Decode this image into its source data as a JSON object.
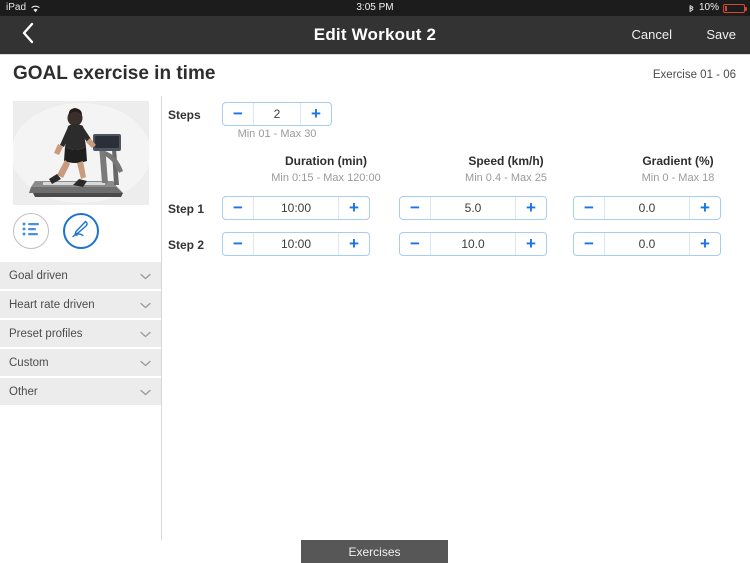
{
  "statusbar": {
    "device": "iPad",
    "wifi_icon": "wifi-icon",
    "time": "3:05 PM",
    "bluetooth_icon": "bluetooth-icon",
    "battery_pct": "10%",
    "battery_icon": "battery-low-icon",
    "battery_color": "#d64632"
  },
  "navbar": {
    "back_icon": "chevron-left-icon",
    "title": "Edit Workout 2",
    "cancel_label": "Cancel",
    "save_label": "Save",
    "background": "#333333"
  },
  "page": {
    "title": "GOAL exercise in time",
    "exercise_counter": "Exercise 01 - 06"
  },
  "left_panel": {
    "preview_alt": "treadmill-runner-image",
    "icons": [
      {
        "name": "list-view-icon",
        "active": false
      },
      {
        "name": "pen-edit-icon",
        "active": true
      }
    ]
  },
  "sidebar": {
    "items": [
      {
        "label": "Goal driven",
        "icon": "chevron-down-icon"
      },
      {
        "label": "Heart rate driven",
        "icon": "chevron-down-icon"
      },
      {
        "label": "Preset profiles",
        "icon": "chevron-down-icon"
      },
      {
        "label": "Custom",
        "icon": "chevron-down-icon"
      },
      {
        "label": "Other",
        "icon": "chevron-down-icon"
      }
    ]
  },
  "form": {
    "steps": {
      "label": "Steps",
      "value": "2",
      "range": "Min 01 - Max 30",
      "minus_icon": "minus-icon",
      "plus_icon": "plus-icon"
    },
    "columns": [
      {
        "header": "Duration (min)",
        "range": "Min 0:15 - Max 120:00"
      },
      {
        "header": "Speed (km/h)",
        "range": "Min 0.4 - Max 25"
      },
      {
        "header": "Gradient (%)",
        "range": "Min 0 - Max 18"
      }
    ],
    "rows": [
      {
        "label": "Step 1",
        "duration": "10:00",
        "speed": "5.0",
        "gradient": "0.0"
      },
      {
        "label": "Step 2",
        "duration": "10:00",
        "speed": "10.0",
        "gradient": "0.0"
      }
    ],
    "minus_icon": "minus-icon",
    "plus_icon": "plus-icon",
    "accent_color": "#1a73e8",
    "border_color": "#a8cdf0"
  },
  "bottom": {
    "tab_label": "Exercises"
  }
}
